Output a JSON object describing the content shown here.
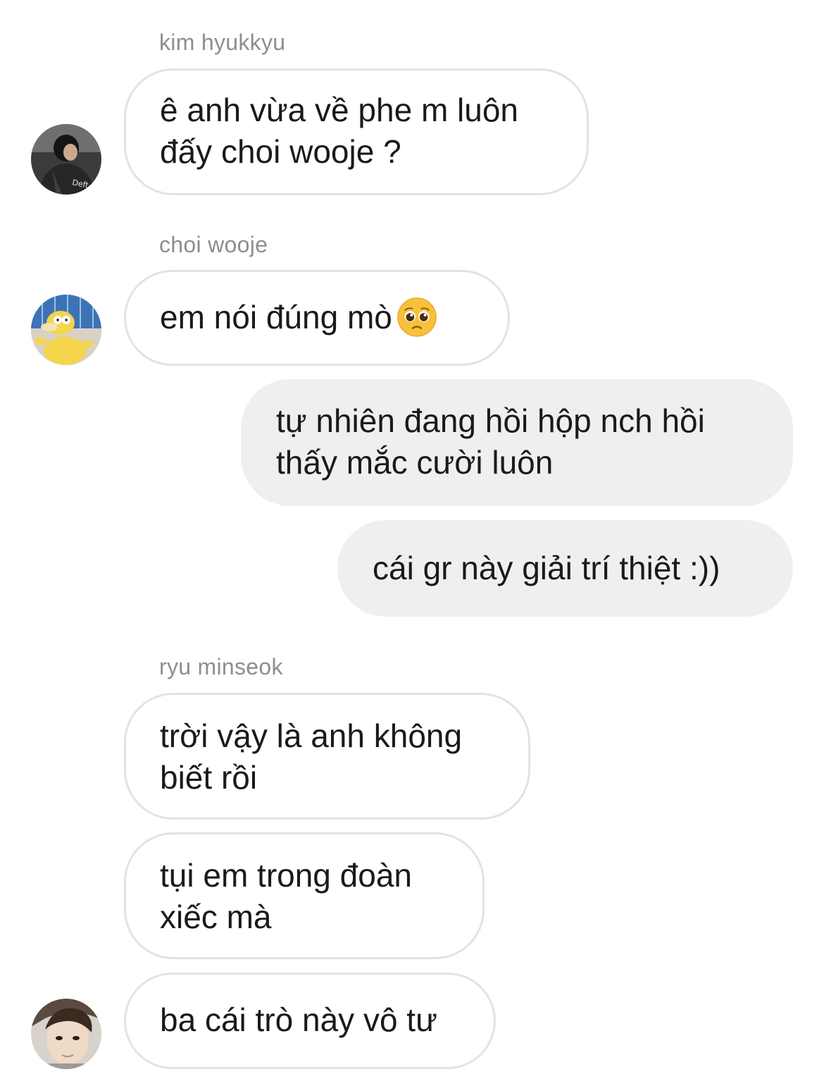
{
  "messages": [
    {
      "sender": "kim hyukkyu",
      "lines": [
        "ê anh vừa về phe m luôn",
        "đấy choi wooje ?"
      ],
      "avatar": "avatar-kim-hyukkyu",
      "avatar_text": "Deft"
    },
    {
      "sender": "choi wooje",
      "text": "em nói đúng mò",
      "emoji": "pleading-face-emoji",
      "avatar": "avatar-choi-wooje"
    },
    {
      "from": "me",
      "lines": [
        "tự nhiên đang hồi hộp nch hồi",
        "thấy mắc cười luôn"
      ]
    },
    {
      "from": "me",
      "text": "cái gr này giải trí thiệt :))"
    },
    {
      "sender": "ryu minseok",
      "lines": [
        "trời vậy là anh không",
        "biết rồi"
      ]
    },
    {
      "lines": [
        "tụi em trong đoàn",
        "xiếc mà"
      ]
    },
    {
      "text": "ba cái trò này vô tư",
      "avatar": "avatar-ryu-minseok"
    }
  ],
  "colors": {
    "incoming_border": "#e3e3e3",
    "outgoing_bg": "#efefef",
    "sender_name": "#8e8e8e",
    "text": "#1a1a1a"
  }
}
